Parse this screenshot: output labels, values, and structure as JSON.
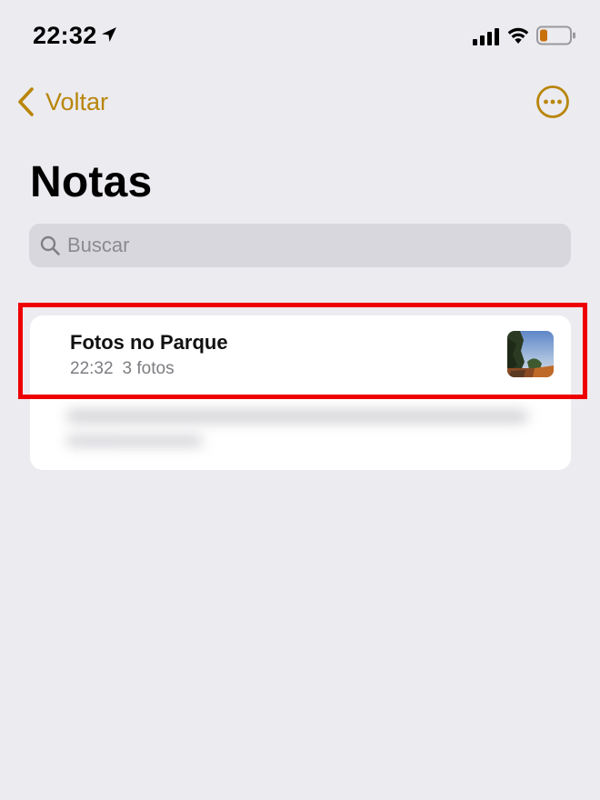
{
  "status_bar": {
    "time": "22:32",
    "icons": [
      "location-arrow-icon",
      "cellular-signal-icon",
      "wifi-icon",
      "battery-low-icon"
    ],
    "battery_color": "#C8700A"
  },
  "navigation": {
    "back_label": "Voltar",
    "back_icon": "chevron-left-icon",
    "more_icon": "ellipsis-circle-icon",
    "accent_color": "#B8860B"
  },
  "page": {
    "title": "Notas"
  },
  "search": {
    "placeholder": "Buscar",
    "value": "",
    "icon": "search-icon"
  },
  "notes": [
    {
      "title": "Fotos no Parque",
      "time": "22:32",
      "detail": "3 fotos",
      "thumbnail": "photo-thumbnail",
      "highlighted": true
    }
  ],
  "highlight_color": "#EE0000"
}
